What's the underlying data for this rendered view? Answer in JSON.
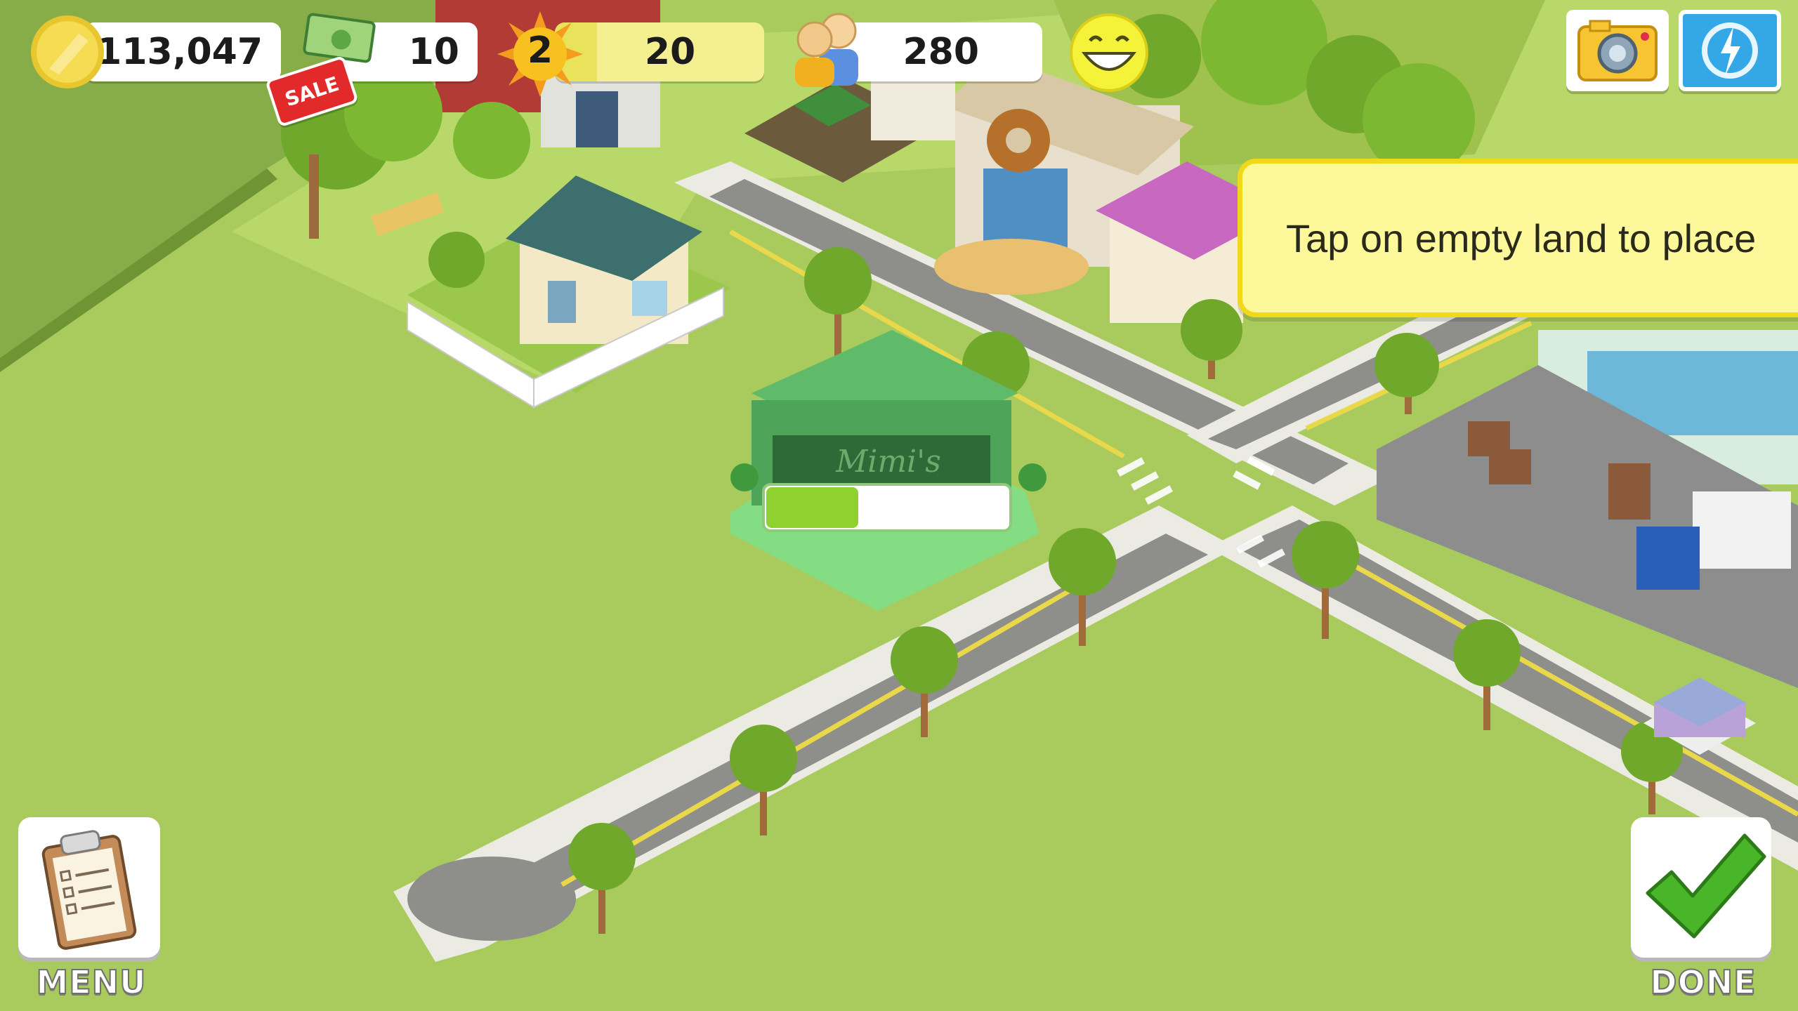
{
  "hud": {
    "coins": "113,047",
    "cash": "10",
    "sale_badge": "SALE",
    "level": "2",
    "xp": "20",
    "xp_progress": 0.2,
    "population": "280"
  },
  "tooltip": {
    "text": "Tap on empty land to place"
  },
  "placing_building": {
    "name": "Mimi's",
    "build_progress": 0.38
  },
  "buttons": {
    "menu_label": "MENU",
    "done_label": "DONE"
  },
  "icons": {
    "coin": "coin-icon",
    "cash": "cash-icon",
    "level": "sun-level-icon",
    "population": "population-icon",
    "happiness": "smiley-icon",
    "camera": "camera-icon",
    "bolt": "bolt-icon",
    "menu": "clipboard-icon",
    "done": "checkmark-icon"
  },
  "colors": {
    "grass": "#a9cb5e",
    "tooltip_bg": "#fdf89a",
    "progress_fill": "#8fd12f",
    "done_check": "#49b62a"
  }
}
